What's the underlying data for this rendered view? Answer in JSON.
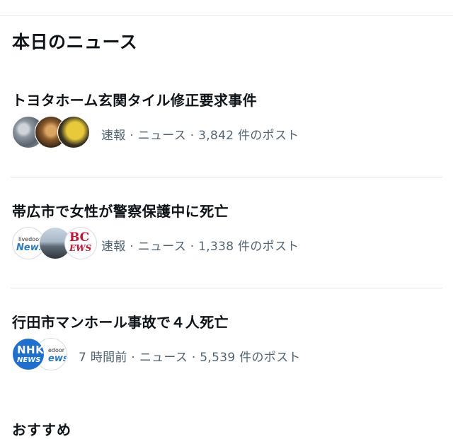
{
  "section": {
    "title": "本日のニュース"
  },
  "items": [
    {
      "headline": "トヨタホーム玄関タイル修正要求事件",
      "meta": "速報 · ニュース · 3,842 件のポスト",
      "avatars": [
        "photo-avatar",
        "photo-avatar",
        "photo-avatar"
      ]
    },
    {
      "headline": "帯広市で女性が警察保護中に死亡",
      "meta": "速報 · ニュース · 1,338 件のポスト",
      "avatars": [
        "livedoor-news-logo",
        "photo-avatar",
        "bc-news-logo"
      ],
      "logos": {
        "livedoor_small": "livedoor",
        "livedoor_news": "News",
        "bc_top": "BC",
        "bc_bottom": "EWS"
      }
    },
    {
      "headline": "行田市マンホール事故で４人死亡",
      "meta": "7 時間前 · ニュース · 5,539 件のポスト",
      "avatars": [
        "nhk-news-logo",
        "livedoor-news-logo"
      ],
      "logos": {
        "nhk_top": "NHK",
        "nhk_bottom": "NEWS",
        "livedoor_small": "edoor",
        "livedoor_news": "ews"
      }
    }
  ],
  "footer_partial": {
    "text": "おすすめ"
  },
  "colors": {
    "text": "#0f1419",
    "meta": "#536471",
    "divider": "#e1e4e6",
    "nhk": "#1d6fd0"
  }
}
